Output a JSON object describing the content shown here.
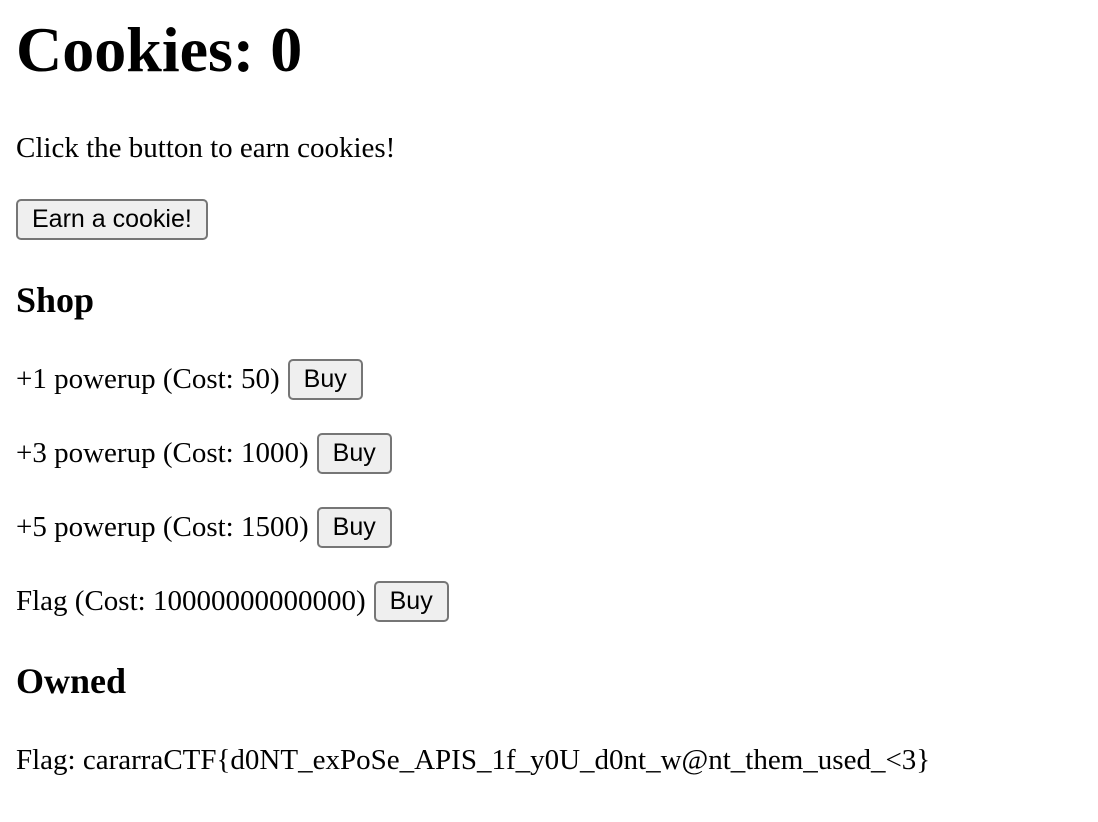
{
  "header": {
    "cookies_text": "Cookies: 0"
  },
  "intro": {
    "text": "Click the button to earn cookies!"
  },
  "earn": {
    "button_label": "Earn a cookie!"
  },
  "shop": {
    "heading": "Shop",
    "items": [
      {
        "label": "+1 powerup (Cost: 50)",
        "button_label": "Buy"
      },
      {
        "label": "+3 powerup (Cost: 1000)",
        "button_label": "Buy"
      },
      {
        "label": "+5 powerup (Cost: 1500)",
        "button_label": "Buy"
      },
      {
        "label": "Flag (Cost: 10000000000000)",
        "button_label": "Buy"
      }
    ]
  },
  "owned": {
    "heading": "Owned",
    "flag_text": "Flag: cararraCTF{d0NT_exPoSe_APIS_1f_y0U_d0nt_w@nt_them_used_<3}"
  }
}
